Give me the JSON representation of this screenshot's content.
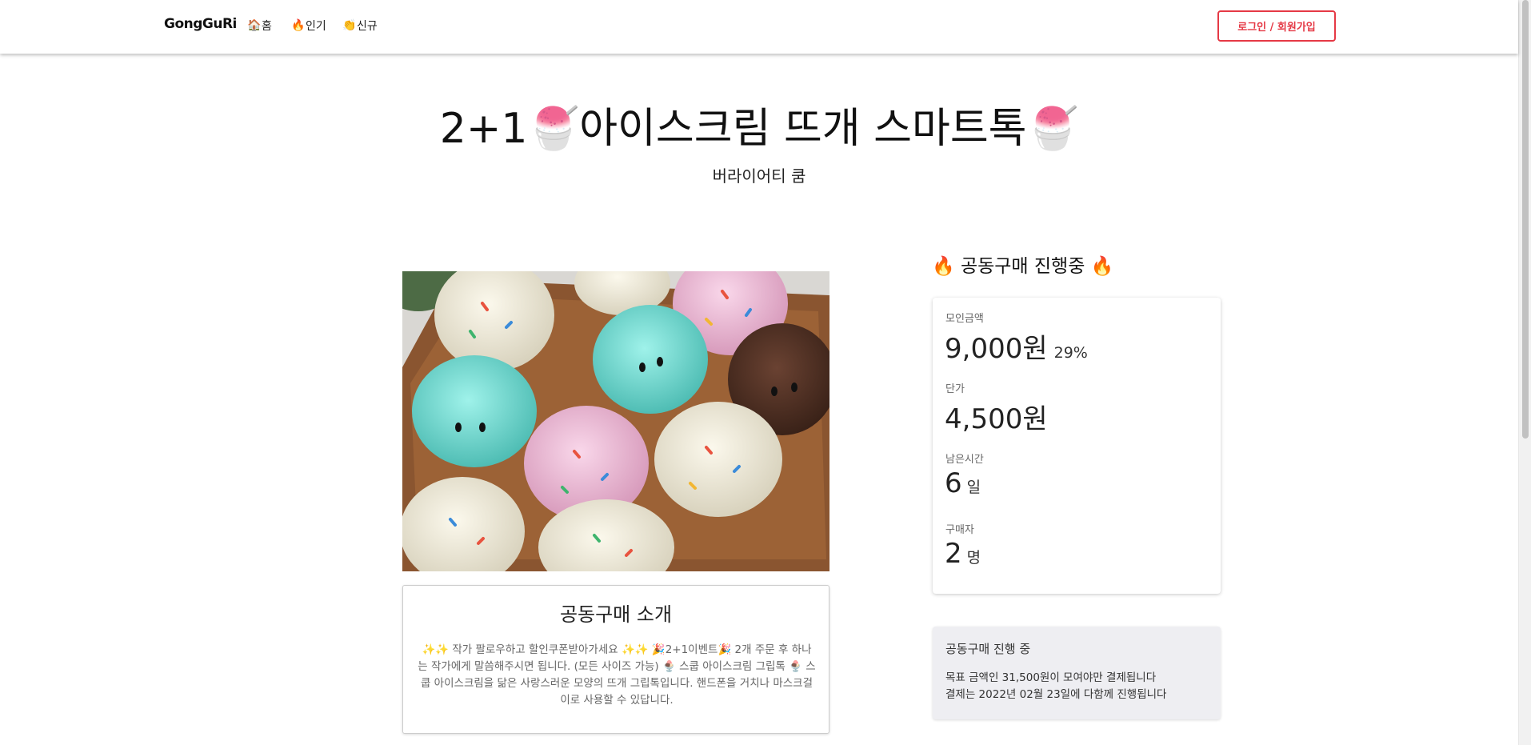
{
  "header": {
    "logo": "GongGuRi",
    "nav": [
      {
        "label": "홈",
        "icon": "home-icon",
        "glyph": "🏠"
      },
      {
        "label": "인기",
        "icon": "fire-icon",
        "glyph": "🔥"
      },
      {
        "label": "신규",
        "icon": "new-sparkle-icon",
        "glyph": "👏"
      }
    ],
    "login_label": "로그인 / 회원가입"
  },
  "product": {
    "title": "2+1🍧아이스크림 뜨개 스마트톡🍧",
    "seller": "버라이어티 쿰"
  },
  "intro": {
    "title": "공동구매 소개",
    "body": "✨✨ 작가 팔로우하고 할인쿠폰받아가세요 ✨✨ 🎉2+1이벤트🎉 2개 주문 후 하나는 작가에게 말씀해주시면 됩니다. (모든 사이즈 가능) 🍨 스쿱 아이스크림 그립톡 🍨 스쿱 아이스크림을 닮은 사랑스러운 모양의 뜨개 그립톡입니다. 핸드폰을 거치나 마스크걸이로 사용할 수 있답니다."
  },
  "status": {
    "heading": "🔥 공동구매 진행중 🔥",
    "collected_label": "모인금액",
    "collected_value": "9,000원",
    "collected_percent": "29%",
    "price_label": "단가",
    "price_value": "4,500원",
    "remaining_label": "남은시간",
    "remaining_value": "6",
    "remaining_unit": "일",
    "buyers_label": "구매자",
    "buyers_value": "2",
    "buyers_unit": "명"
  },
  "notice": {
    "title": "공동구매 진행 중",
    "line1": "목표 금액인 31,500원이 모여야만 결제됩니다",
    "line2": "결제는 2022년 02월 23일에 다함께 진행됩니다"
  },
  "colors": {
    "accent": "#e53945",
    "notice_bg": "#eeeef2"
  }
}
